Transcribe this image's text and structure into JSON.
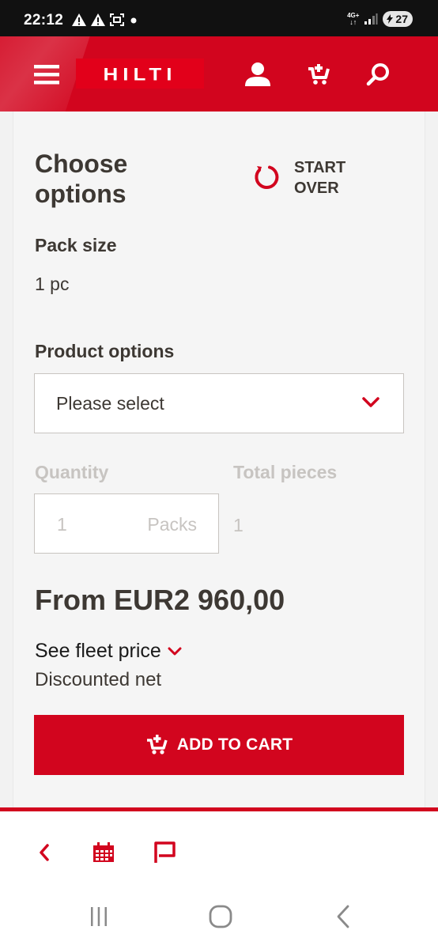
{
  "status_bar": {
    "time": "22:12",
    "network": "4G+",
    "battery": "27",
    "icons": [
      "warning-icon",
      "warning-icon",
      "screenshot-icon",
      "dot-icon",
      "signal-icon",
      "battery-icon"
    ]
  },
  "header": {
    "logo_text": "HILTI",
    "icons": [
      "menu-icon",
      "account-icon",
      "cart-icon",
      "search-icon"
    ],
    "brand_color": "#d2051e"
  },
  "options": {
    "title": "Choose options",
    "start_over": "START OVER",
    "pack_size_label": "Pack size",
    "pack_size_value": "1 pc",
    "product_options_label": "Product options",
    "product_options_placeholder": "Please select",
    "quantity_label": "Quantity",
    "quantity_value": "1",
    "quantity_unit": "Packs",
    "total_pieces_label": "Total pieces",
    "total_pieces_value": "1"
  },
  "price": {
    "from_price": "From EUR2 960,00",
    "fleet_link": "See fleet price",
    "discount_note": "Discounted net"
  },
  "cart": {
    "add_to_cart": "ADD TO CART"
  },
  "toolbar": {
    "icons": [
      "back-icon",
      "calendar-icon",
      "flag-icon"
    ]
  },
  "navbar": {
    "icons": [
      "recents-icon",
      "home-icon",
      "back-icon"
    ]
  }
}
